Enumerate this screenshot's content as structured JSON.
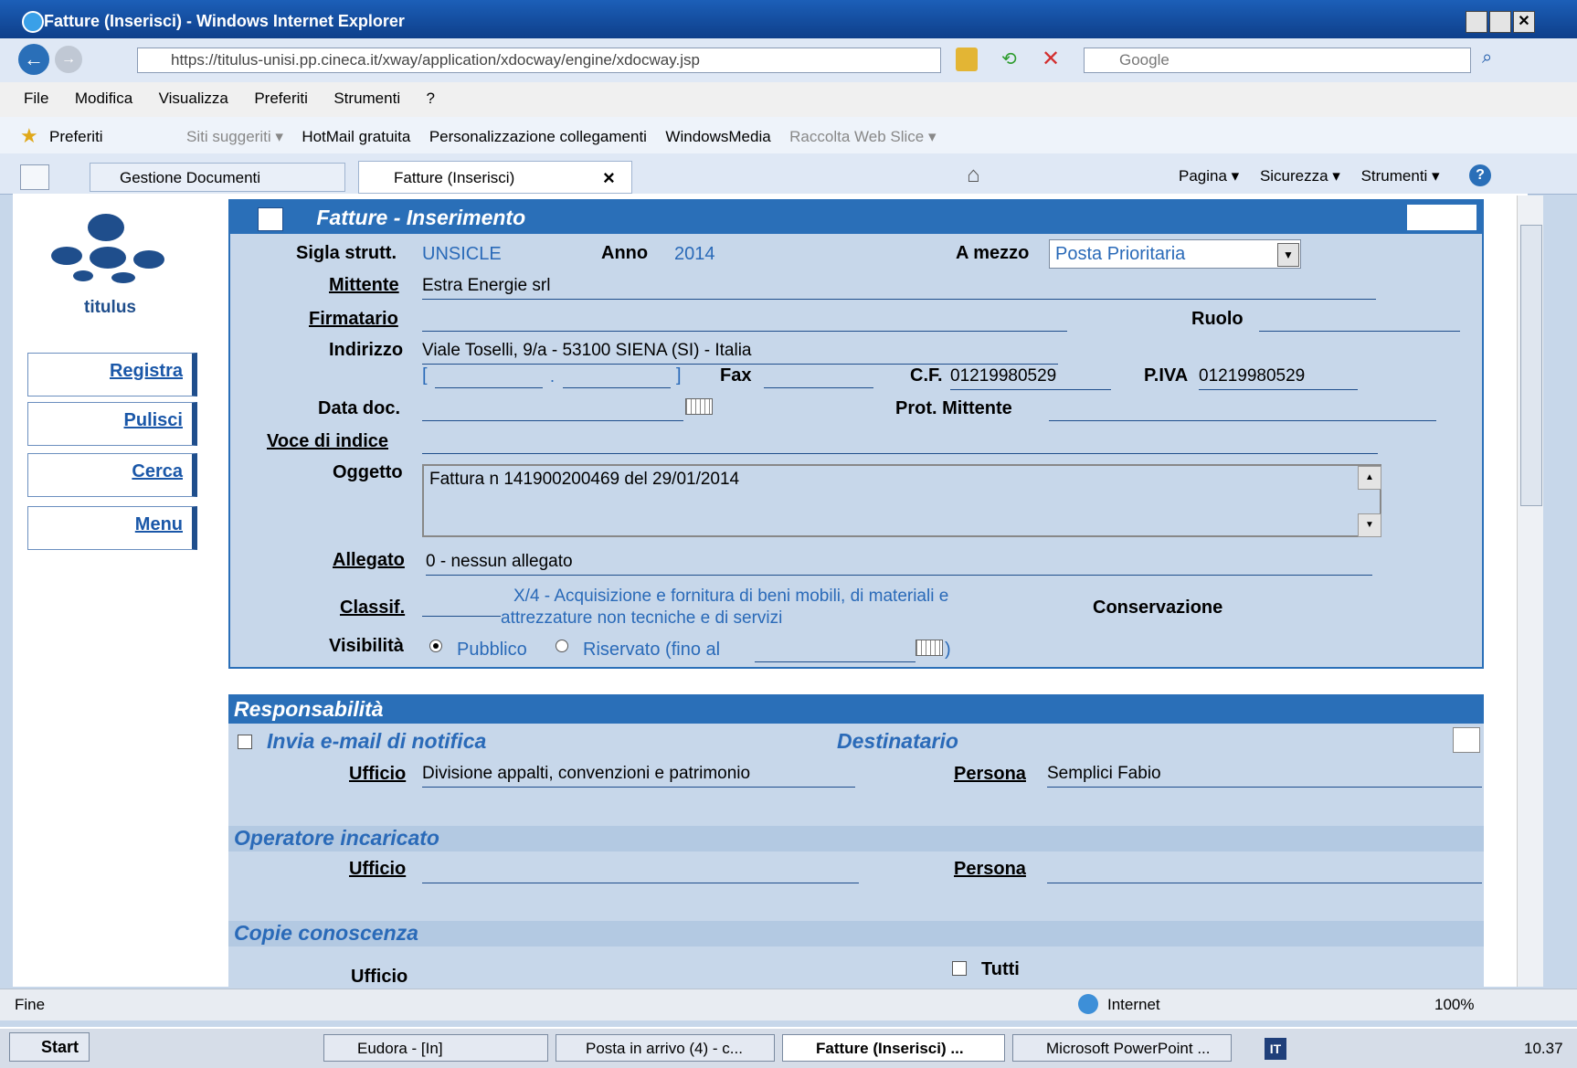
{
  "window": {
    "title": "Fatture (Inserisci) - Windows Internet Explorer"
  },
  "address": {
    "url": "https://titulus-unisi.pp.cineca.it/xway/application/xdocway/engine/xdocway.jsp",
    "search_placeholder": "Google"
  },
  "menubar": {
    "items": [
      "File",
      "Modifica",
      "Visualizza",
      "Preferiti",
      "Strumenti",
      "?"
    ]
  },
  "favorites": {
    "label": "Preferiti",
    "items": [
      "Siti suggeriti ▾",
      "HotMail gratuita",
      "Personalizzazione collegamenti",
      "WindowsMedia",
      "Raccolta Web Slice ▾"
    ]
  },
  "tabs": {
    "items": [
      "Gestione Documenti",
      "Fatture (Inserisci)"
    ],
    "close": "×"
  },
  "commandbar": {
    "items": [
      "Pagina ▾",
      "Sicurezza ▾",
      "Strumenti ▾"
    ]
  },
  "sidebar": {
    "logo_text": "titulus",
    "buttons": [
      "Registra",
      "Pulisci",
      "Cerca",
      "Menu"
    ]
  },
  "form": {
    "title": "Fatture - Inserimento",
    "sigla_label": "Sigla strutt.",
    "sigla_value": "UNSICLE",
    "anno_label": "Anno",
    "anno_value": "2014",
    "mezzo_label": "A mezzo",
    "mezzo_value": "Posta Prioritaria",
    "mittente_label": "Mittente",
    "mittente_value": "Estra Energie srl",
    "firmatario_label": "Firmatario",
    "ruolo_label": "Ruolo",
    "indirizzo_label": "Indirizzo",
    "indirizzo_value": "Viale Toselli, 9/a - 53100 SIENA (SI) - Italia",
    "email_open": "[",
    "email_dot": ".",
    "email_close": "]",
    "fax_label": "Fax",
    "cf_label": "C.F.",
    "cf_value": "01219980529",
    "piva_label": "P.IVA",
    "piva_value": "01219980529",
    "datadoc_label": "Data doc.",
    "prot_label": "Prot. Mittente",
    "voce_label": "Voce di indice",
    "oggetto_label": "Oggetto",
    "oggetto_value": "Fattura n 141900200469 del 29/01/2014",
    "allegato_label": "Allegato",
    "allegato_value": "0 - nessun allegato",
    "classif_label": "Classif.",
    "classif_value_1": "X/4 - Acquisizione e fornitura di beni mobili, di materiali e",
    "classif_value_2": "attrezzature non tecniche e di servizi",
    "conservazione_label": "Conservazione",
    "visibilita_label": "Visibilità",
    "pubblico_label": "Pubblico",
    "riservato_label": "Riservato (fino al",
    "riservato_close": ")"
  },
  "resp": {
    "title": "Responsabilità",
    "notifica_label": "Invia e-mail di notifica",
    "destinatario_label": "Destinatario",
    "ufficio_label": "Ufficio",
    "ufficio_value": "Divisione appalti, convenzioni e patrimonio",
    "persona_label": "Persona",
    "persona_value": "Semplici Fabio",
    "operatore_title": "Operatore incaricato",
    "copie_title": "Copie conoscenza",
    "tutti_label": "Tutti"
  },
  "statusbar": {
    "left": "Fine",
    "zone": "Internet",
    "zoom": "100%"
  },
  "taskbar": {
    "start": "Start",
    "items": [
      "Eudora - [In]",
      "Posta in arrivo (4) - c...",
      "Fatture (Inserisci) ...",
      "Microsoft PowerPoint ..."
    ],
    "lang": "IT",
    "clock": "10.37"
  },
  "colors": {
    "accent": "#2a6fb8",
    "form_bg": "#c7d7ea",
    "link": "#1a57a8"
  }
}
